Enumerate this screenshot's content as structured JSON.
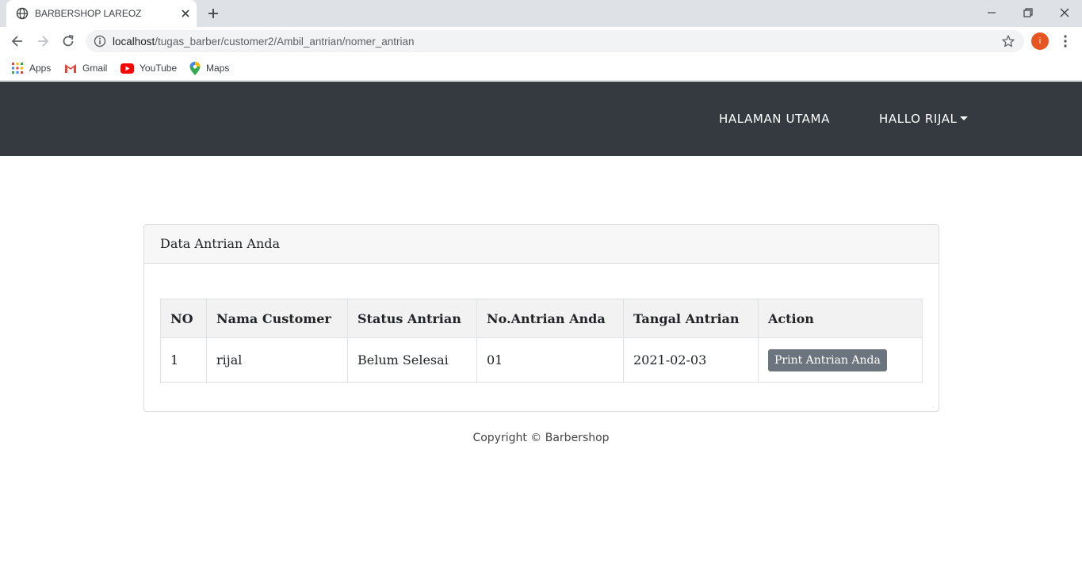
{
  "browser": {
    "tab_title": "BARBERSHOP LAREOZ",
    "url_host": "localhost",
    "url_path": "/tugas_barber/customer2/Ambil_antrian/nomer_antrian",
    "avatar_letter": "i",
    "avatar_color": "#e8541f",
    "bookmarks": [
      {
        "label": "Apps",
        "icon": "apps-grid-icon"
      },
      {
        "label": "Gmail",
        "icon": "gmail-icon"
      },
      {
        "label": "YouTube",
        "icon": "youtube-icon"
      },
      {
        "label": "Maps",
        "icon": "maps-pin-icon"
      }
    ]
  },
  "navbar": {
    "background": "#343a40",
    "home_link": "HALAMAN UTAMA",
    "user_menu": "HALLO RIJAL"
  },
  "card": {
    "title": "Data Antrian Anda",
    "table": {
      "columns": [
        "NO",
        "Nama Customer",
        "Status Antrian",
        "No.Antrian Anda",
        "Tangal Antrian",
        "Action"
      ],
      "rows": [
        {
          "no": "1",
          "nama": "rijal",
          "status": "Belum Selesai",
          "nomor": "01",
          "tanggal": "2021-02-03",
          "action": "Print Antrian Anda"
        }
      ]
    }
  },
  "footer": {
    "text": "Copyright © Barbershop"
  }
}
